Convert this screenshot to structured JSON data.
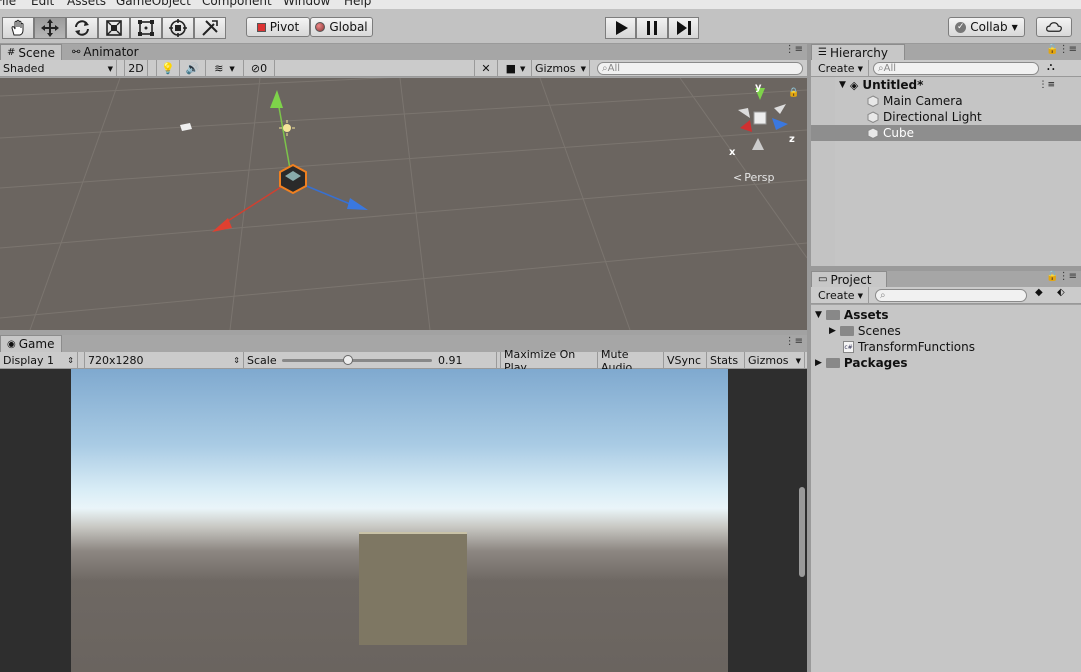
{
  "menu": [
    "File",
    "Edit",
    "Assets",
    "GameObject",
    "Component",
    "Window",
    "Help"
  ],
  "toolbar": {
    "tools": [
      "hand-icon",
      "move-icon",
      "rotate-icon",
      "scale-icon",
      "rect-tool-icon",
      "transform-tool-icon",
      "custom-tool-icon"
    ],
    "pivot_label": "Pivot",
    "global_label": "Global",
    "collab_label": "Collab"
  },
  "scene": {
    "tab_label": "Scene",
    "animator_label": "Animator",
    "shading": "Shaded",
    "mode_2d": "2D",
    "hidden_count": "0",
    "gizmos_label": "Gizmos",
    "search_placeholder": "All",
    "persp_label": "Persp",
    "axis_y": "y",
    "axis_x": "x",
    "axis_z": "z"
  },
  "game": {
    "tab_label": "Game",
    "display": "Display 1",
    "resolution": "720x1280",
    "scale_label": "Scale",
    "scale_value": "0.91",
    "scale_fraction": 0.44,
    "maximize_label": "Maximize On Play",
    "mute_label": "Mute Audio",
    "vsync_label": "VSync",
    "stats_label": "Stats",
    "gizmos_label": "Gizmos"
  },
  "hierarchy": {
    "tab_label": "Hierarchy",
    "create_label": "Create",
    "search_placeholder": "All",
    "scene_name": "Untitled*",
    "items": [
      "Main Camera",
      "Directional Light",
      "Cube"
    ],
    "selected_index": 2
  },
  "project": {
    "tab_label": "Project",
    "create_label": "Create",
    "tree": [
      {
        "label": "Assets",
        "depth": 0,
        "bold": true,
        "expanded": true
      },
      {
        "label": "Scenes",
        "depth": 1,
        "bold": false,
        "expanded": false
      },
      {
        "label": "TransformFunctions",
        "depth": 1,
        "bold": false,
        "script": true
      },
      {
        "label": "Packages",
        "depth": 0,
        "bold": true,
        "expanded": false
      }
    ],
    "script_badge": "c#"
  }
}
